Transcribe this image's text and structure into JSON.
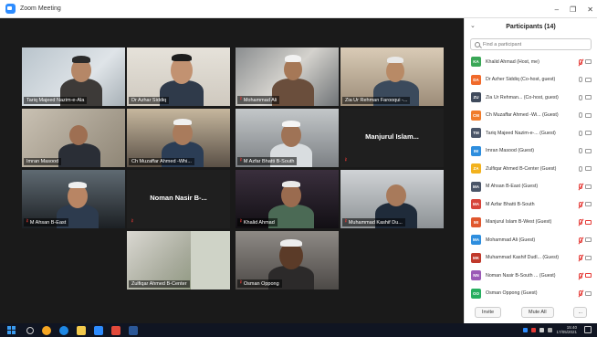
{
  "window": {
    "title": "Zoom Meeting"
  },
  "tiles": [
    {
      "name": "Tariq Majeed Nazim-e-Ala",
      "muted": false
    },
    {
      "name": "Dr Azhar Siddiq",
      "muted": false
    },
    {
      "name": "Mohammad Ali",
      "muted": true
    },
    {
      "name": "Zia Ur Rehman Farooqui -...",
      "muted": false
    },
    {
      "name": "Imran Masood",
      "muted": false
    },
    {
      "name": "Ch Muzaffar Ahmed -Whi...",
      "muted": false
    },
    {
      "name": "M Azfar Bhatti B-South",
      "muted": true
    },
    {
      "name": "Manjurul Islam...",
      "muted": true,
      "label_only": true
    },
    {
      "name": "M Ahsan B-East",
      "muted": true
    },
    {
      "name": "Noman Nasir B-...",
      "muted": true,
      "label_only": true
    },
    {
      "name": "Khalid Ahmad",
      "muted": true
    },
    {
      "name": "Muhammad Kashif Du...",
      "muted": true
    },
    {
      "name": "Zulfiqar Ahmed B-Center",
      "muted": false
    },
    {
      "name": "Osman Oppong",
      "muted": true
    }
  ],
  "panel": {
    "title": "Participants (14)",
    "search_placeholder": "Find a participant",
    "invite_label": "Invite",
    "mute_all_label": "Mute All",
    "more_label": "...",
    "minimize": "–",
    "maximize": "❐",
    "close": "✕",
    "participants": [
      {
        "initials": "KA",
        "name": "Khalid Ahmad (Host, me)",
        "color": "#3aa757",
        "mic_muted": true,
        "cam_off": false
      },
      {
        "initials": "DA",
        "name": "Dr Azher Siddiq (Co-host, guest)",
        "color": "#f06a2b",
        "mic_muted": false,
        "cam_off": false
      },
      {
        "initials": "ZU",
        "name": "Zia Ur Rehman... (Co-host, guest)",
        "color": "#3f4a5c",
        "mic_muted": false,
        "cam_off": false
      },
      {
        "initials": "CM",
        "name": "Ch Muzaffar Ahmed -Wi... (Guest)",
        "color": "#f07c2b",
        "mic_muted": false,
        "cam_off": false
      },
      {
        "initials": "TM",
        "name": "Tariq Majeed Nazim-e-... (Guest)",
        "color": "#4a5568",
        "mic_muted": false,
        "cam_off": false
      },
      {
        "initials": "IM",
        "name": "Imran Masood (Guest)",
        "color": "#2e8ede",
        "mic_muted": false,
        "cam_off": false
      },
      {
        "initials": "ZA",
        "name": "Zulfiqar Ahmed B-Center (Guest)",
        "color": "#f2b21e",
        "mic_muted": false,
        "cam_off": false
      },
      {
        "initials": "MA",
        "name": "M Ahsan B-East (Guest)",
        "color": "#4a5568",
        "mic_muted": true,
        "cam_off": false
      },
      {
        "initials": "MA",
        "name": "M Azfar Bhatti B-South",
        "color": "#d6453a",
        "mic_muted": true,
        "cam_off": false
      },
      {
        "initials": "MI",
        "name": "Manjurul Islam B-West (Guest)",
        "color": "#e0582f",
        "mic_muted": true,
        "cam_off": true
      },
      {
        "initials": "MA",
        "name": "Mohammad Ali (Guest)",
        "color": "#2e8ede",
        "mic_muted": true,
        "cam_off": false
      },
      {
        "initials": "MK",
        "name": "Muhammad Kashif Dudl... (Guest)",
        "color": "#c0392b",
        "mic_muted": true,
        "cam_off": false
      },
      {
        "initials": "NN",
        "name": "Noman Nasir B-South ... (Guest)",
        "color": "#9b59b6",
        "mic_muted": true,
        "cam_off": true
      },
      {
        "initials": "OO",
        "name": "Osman Oppong (Guest)",
        "color": "#27ae60",
        "mic_muted": true,
        "cam_off": false
      }
    ]
  },
  "taskbar": {
    "time": "15:40",
    "date": "17/05/2021"
  }
}
